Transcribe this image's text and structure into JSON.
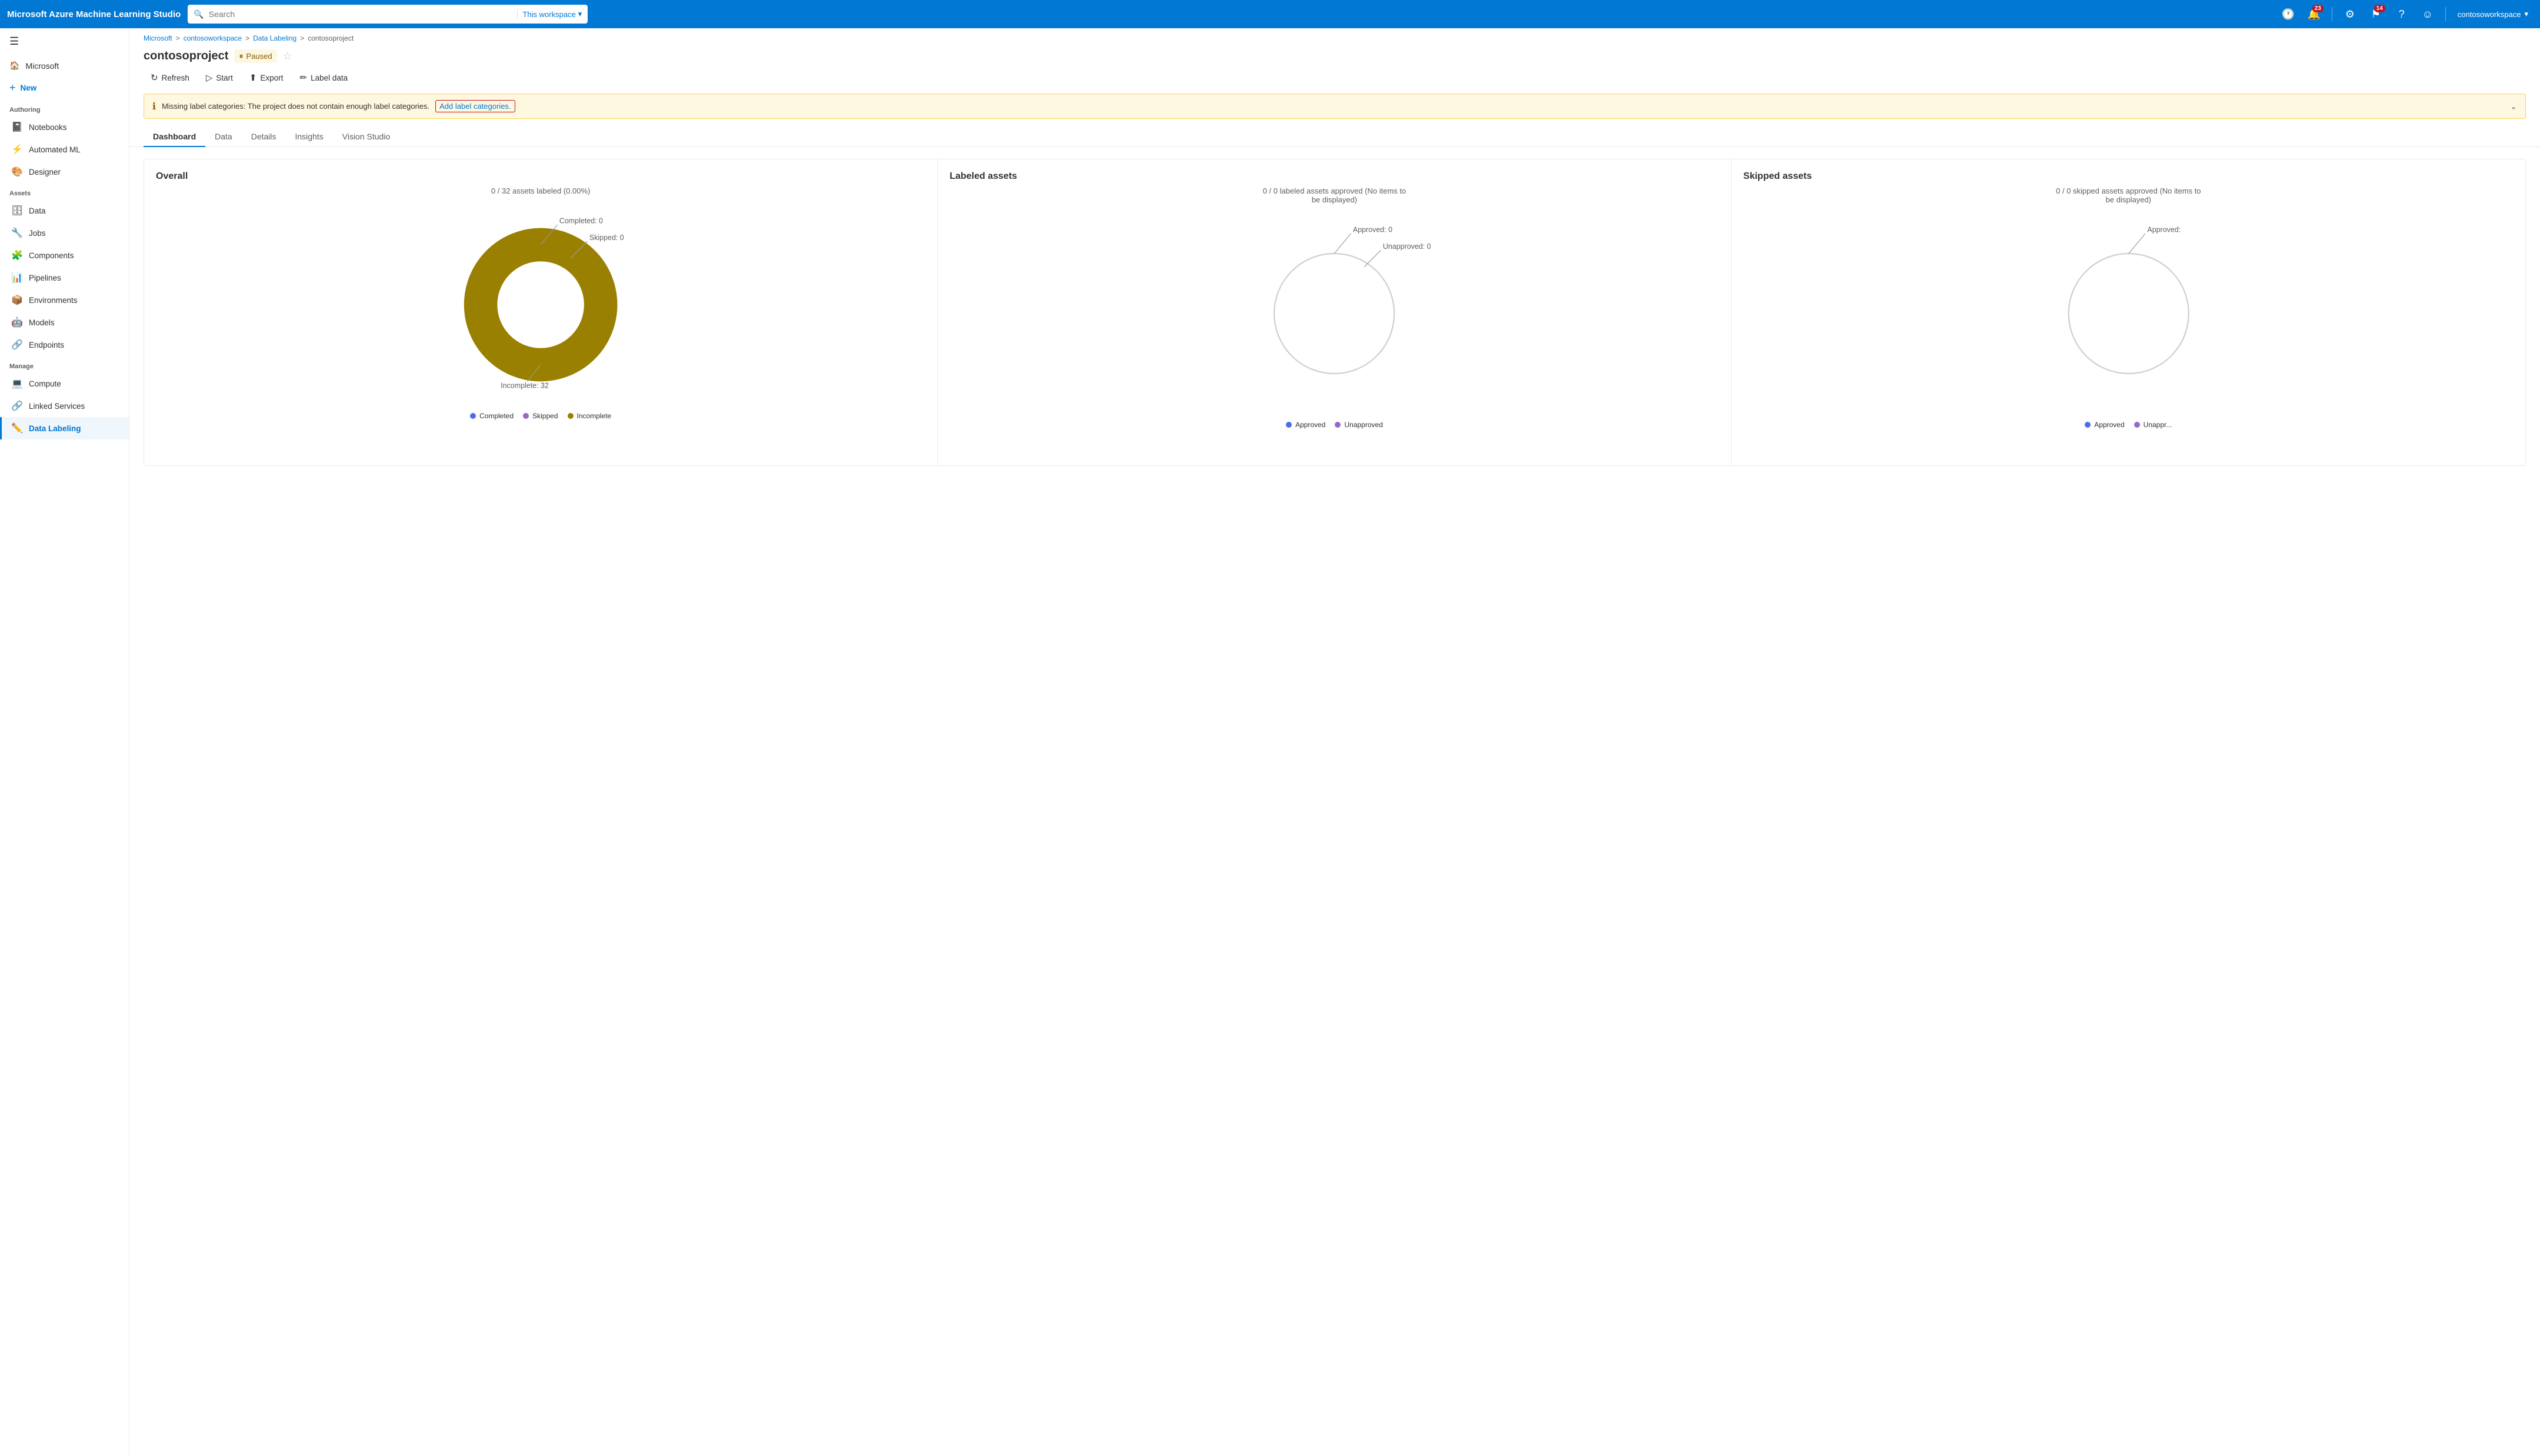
{
  "app": {
    "brand": "Microsoft Azure Machine Learning Studio"
  },
  "topbar": {
    "search_placeholder": "Search",
    "workspace_label": "This workspace",
    "notifications_count": "23",
    "updates_count": "14",
    "user_name": "contosoworkspace"
  },
  "sidebar": {
    "hamburger_icon": "☰",
    "home_label": "Microsoft",
    "new_label": "New",
    "authoring_section": "Authoring",
    "assets_section": "Assets",
    "manage_section": "Manage",
    "items": [
      {
        "id": "notebooks",
        "label": "Notebooks",
        "icon": "📓"
      },
      {
        "id": "automated-ml",
        "label": "Automated ML",
        "icon": "⚡"
      },
      {
        "id": "designer",
        "label": "Designer",
        "icon": "🎨"
      },
      {
        "id": "data",
        "label": "Data",
        "icon": "🗄"
      },
      {
        "id": "jobs",
        "label": "Jobs",
        "icon": "🔧"
      },
      {
        "id": "components",
        "label": "Components",
        "icon": "🧩"
      },
      {
        "id": "pipelines",
        "label": "Pipelines",
        "icon": "📊"
      },
      {
        "id": "environments",
        "label": "Environments",
        "icon": "📦"
      },
      {
        "id": "models",
        "label": "Models",
        "icon": "🤖"
      },
      {
        "id": "endpoints",
        "label": "Endpoints",
        "icon": "🔗"
      },
      {
        "id": "compute",
        "label": "Compute",
        "icon": "💻"
      },
      {
        "id": "linked-services",
        "label": "Linked Services",
        "icon": "🔗"
      },
      {
        "id": "data-labeling",
        "label": "Data Labeling",
        "icon": "✏️",
        "active": true
      }
    ]
  },
  "breadcrumb": {
    "items": [
      "Microsoft",
      "contosoworkspace",
      "Data Labeling",
      "contosoproject"
    ],
    "separators": [
      ">",
      ">",
      ">"
    ]
  },
  "page": {
    "title": "contosoproject",
    "status": "Paused",
    "toolbar": {
      "refresh": "Refresh",
      "start": "Start",
      "export": "Export",
      "label_data": "Label data"
    },
    "warning": {
      "message": "Missing label categories: The project does not contain enough label categories.",
      "link_text": "Add label categories."
    },
    "tabs": [
      "Dashboard",
      "Data",
      "Details",
      "Insights",
      "Vision Studio"
    ],
    "active_tab": "Dashboard"
  },
  "dashboard": {
    "overall": {
      "title": "Overall",
      "subtitle": "0 / 32 assets labeled (0.00%)",
      "completed_label": "Completed: 0",
      "skipped_label": "Skipped: 0",
      "incomplete_label": "Incomplete: 32",
      "legend": [
        {
          "label": "Completed",
          "color": "#4f6bed"
        },
        {
          "label": "Skipped",
          "color": "#9966cc"
        },
        {
          "label": "Incomplete",
          "color": "#9a8000"
        }
      ],
      "data": {
        "completed": 0,
        "skipped": 0,
        "incomplete": 32,
        "total": 32
      }
    },
    "labeled_assets": {
      "title": "Labeled assets",
      "subtitle": "0 / 0 labeled assets approved (No items to be displayed)",
      "approved_label": "Approved: 0",
      "unapproved_label": "Unapproved: 0",
      "legend": [
        {
          "label": "Approved",
          "color": "#4f6bed"
        },
        {
          "label": "Unapproved",
          "color": "#9966cc"
        }
      ]
    },
    "skipped_assets": {
      "title": "Skipped assets",
      "subtitle": "0 / 0 skipped assets approved (No items to be displayed)",
      "approved_label": "Approved:",
      "legend": [
        {
          "label": "Approved",
          "color": "#4f6bed"
        },
        {
          "label": "Unappr...",
          "color": "#9966cc"
        }
      ]
    }
  }
}
